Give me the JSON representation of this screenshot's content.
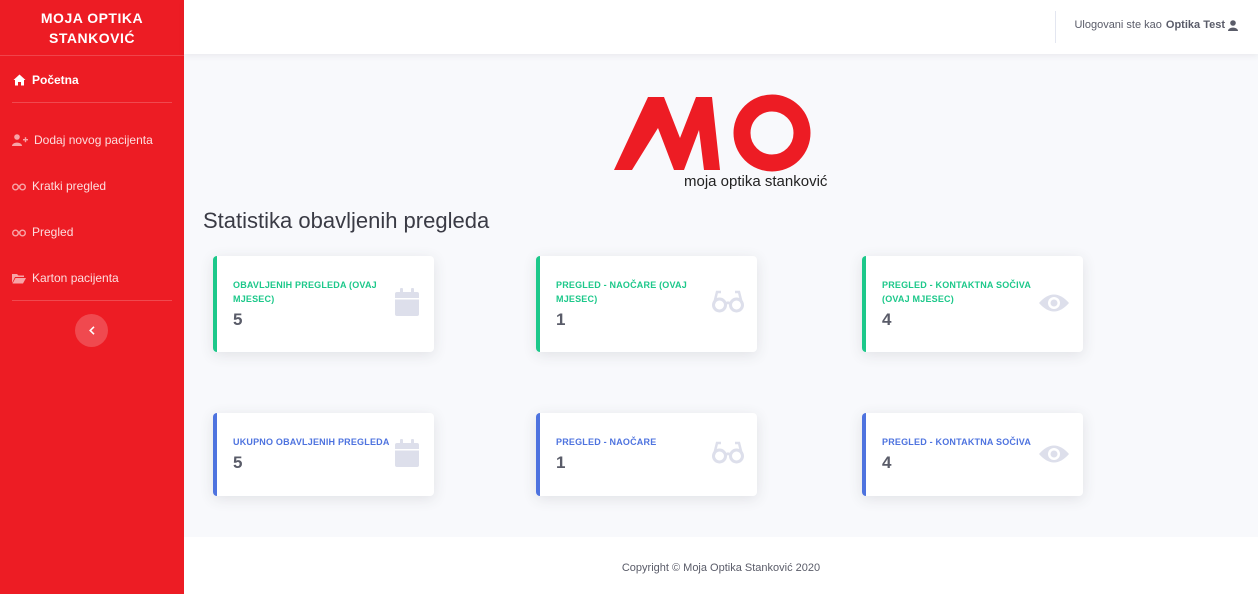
{
  "brand": {
    "line1": "MOJA OPTIKA",
    "line2": "STANKOVIĆ"
  },
  "sidebar": {
    "items": [
      {
        "label": "Početna",
        "icon": "home-icon",
        "active": true
      },
      {
        "label": "Dodaj novog pacijenta",
        "icon": "user-plus-icon"
      },
      {
        "label": "Kratki pregled",
        "icon": "glasses-icon"
      },
      {
        "label": "Pregled",
        "icon": "glasses-icon"
      },
      {
        "label": "Karton pacijenta",
        "icon": "folder-open-icon"
      }
    ],
    "toggle_icon": "chevron-left-icon"
  },
  "topbar": {
    "logged_prefix": "Ulogovani ste kao",
    "username": "Optika Test",
    "icon": "user-icon"
  },
  "logo": {
    "text": "MO",
    "subtitle": "moja optika stanković"
  },
  "page_title": "Statistika obavljenih pregleda",
  "cards": [
    {
      "label": "OBAVLJENIH PREGLEDA (OVAJ MJESEC)",
      "value": "5",
      "icon": "calendar-icon",
      "color": "#1cc88a"
    },
    {
      "label": "PREGLED - NAOČARE (OVAJ MJESEC)",
      "value": "1",
      "icon": "glasses-icon",
      "color": "#1cc88a"
    },
    {
      "label": "PREGLED - KONTAKTNA SOČIVA (OVAJ MJESEC)",
      "value": "4",
      "icon": "eye-icon",
      "color": "#1cc88a"
    },
    {
      "label": "UKUPNO OBAVLJENIH PREGLEDA",
      "value": "5",
      "icon": "calendar-icon",
      "color": "#4e73df"
    },
    {
      "label": "PREGLED - NAOČARE",
      "value": "1",
      "icon": "glasses-icon",
      "color": "#4e73df"
    },
    {
      "label": "PREGLED - KONTAKTNA SOČIVA",
      "value": "4",
      "icon": "eye-icon",
      "color": "#4e73df"
    }
  ],
  "footer": {
    "copyright": "Copyright © Moja Optika Stanković 2020"
  },
  "colors": {
    "sidebar": "#ed1c24",
    "green": "#1cc88a",
    "blue": "#4e73df",
    "icon_gray": "#dddfeb"
  }
}
